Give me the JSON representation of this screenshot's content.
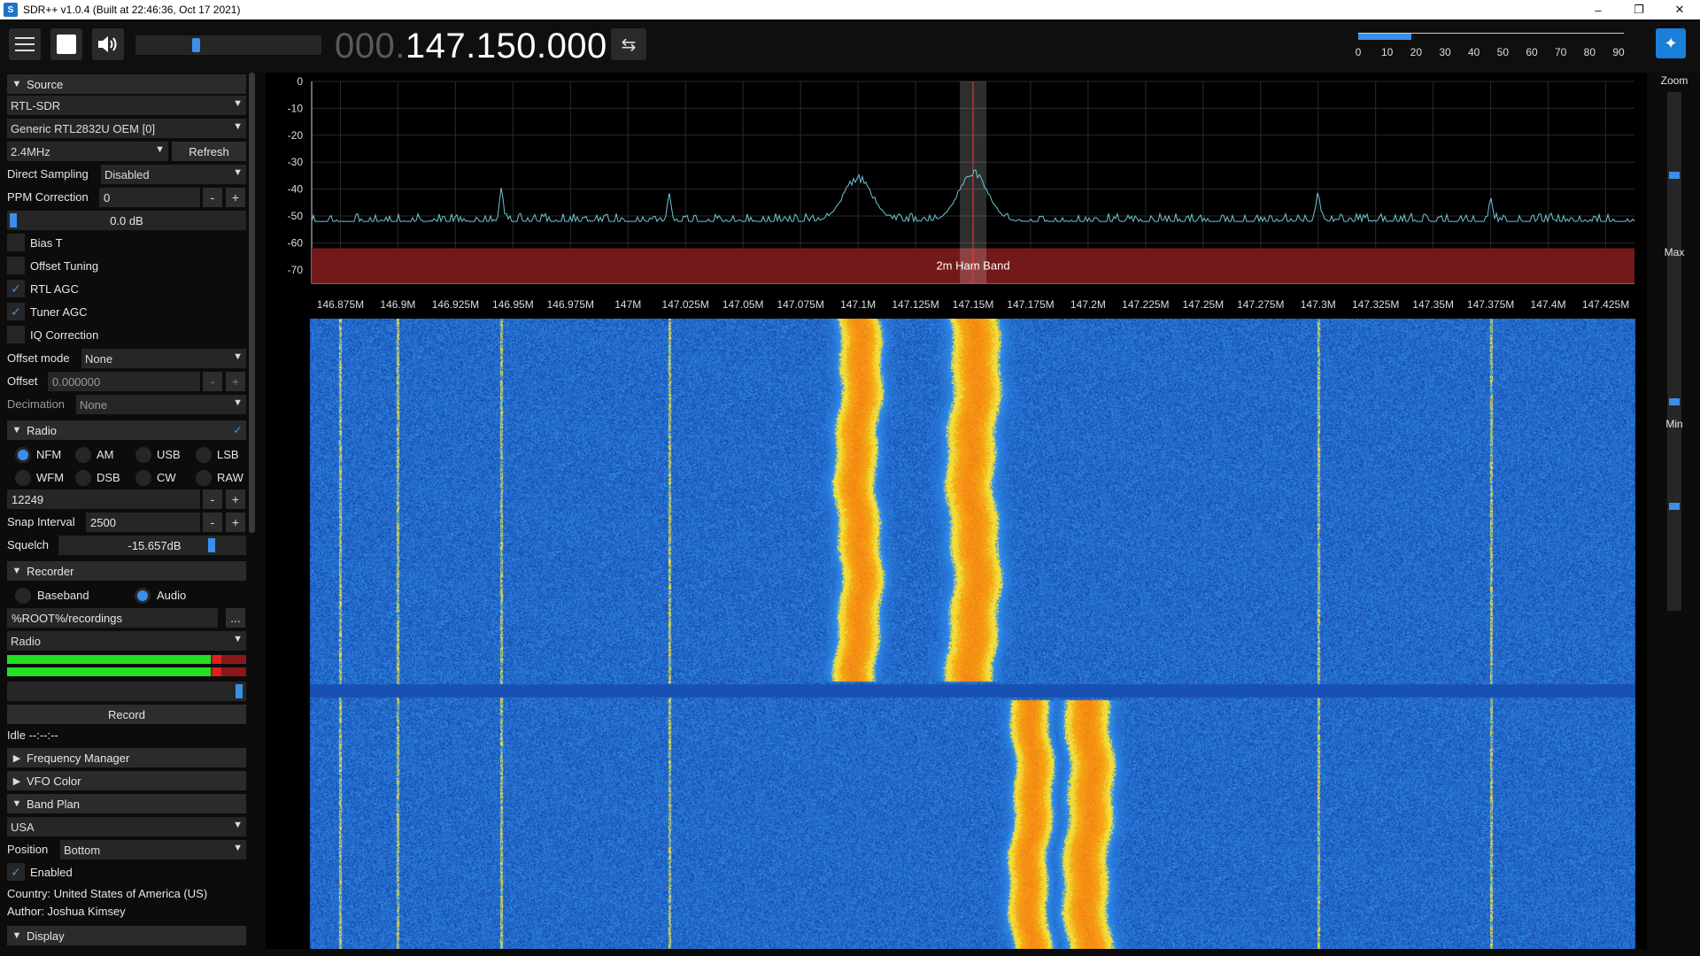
{
  "window": {
    "title": "SDR++ v1.0.4 (Built at 22:46:36, Oct 17 2021)",
    "minimize": "–",
    "maximize": "❐",
    "close": "✕"
  },
  "toolbar": {
    "frequency_dim": "000.",
    "frequency_lit": "147.150.000",
    "swap_icon": "⇆",
    "volume_level": 0.3,
    "snr_scale": [
      "0",
      "10",
      "20",
      "30",
      "40",
      "50",
      "60",
      "70",
      "80",
      "90"
    ],
    "snr_level": 20
  },
  "sidebar": {
    "source": {
      "header": "Source",
      "device_type": "RTL-SDR",
      "device": "Generic RTL2832U OEM [0]",
      "sample_rate": "2.4MHz",
      "refresh": "Refresh",
      "direct_sampling_label": "Direct Sampling",
      "direct_sampling_value": "Disabled",
      "ppm_label": "PPM Correction",
      "ppm_value": "0",
      "gain_value": "0.0 dB",
      "bias_t": "Bias T",
      "offset_tuning": "Offset Tuning",
      "rtl_agc": "RTL AGC",
      "tuner_agc": "Tuner AGC",
      "iq_correction": "IQ Correction",
      "offset_mode_label": "Offset mode",
      "offset_mode_value": "None",
      "offset_label": "Offset",
      "offset_value": "0.000000",
      "decimation_label": "Decimation",
      "decimation_value": "None"
    },
    "radio": {
      "header": "Radio",
      "modes": [
        "NFM",
        "AM",
        "USB",
        "LSB",
        "WFM",
        "DSB",
        "CW",
        "RAW"
      ],
      "selected_mode": "NFM",
      "bandwidth_value": "12249",
      "snap_label": "Snap Interval",
      "snap_value": "2500",
      "squelch_label": "Squelch",
      "squelch_value": "-15.657dB"
    },
    "recorder": {
      "header": "Recorder",
      "baseband": "Baseband",
      "audio": "Audio",
      "path": "%ROOT%/recordings",
      "browse": "...",
      "stream": "Radio",
      "record": "Record",
      "status": "Idle --:--:--"
    },
    "frequency_manager": {
      "header": "Frequency Manager"
    },
    "vfo_color": {
      "header": "VFO Color"
    },
    "band_plan": {
      "header": "Band Plan",
      "plan": "USA",
      "position_label": "Position",
      "position_value": "Bottom",
      "enabled": "Enabled",
      "country": "Country: United States of America (US)",
      "author": "Author: Joshua Kimsey"
    },
    "display": {
      "header": "Display"
    },
    "minus": "-",
    "plus": "+"
  },
  "chart_data": {
    "type": "line",
    "title": "",
    "xlabel": "",
    "ylabel": "",
    "ylim": [
      -75,
      0
    ],
    "y_ticks": [
      "0",
      "-10",
      "-20",
      "-30",
      "-40",
      "-50",
      "-60",
      "-70"
    ],
    "x_ticks": [
      "146.875M",
      "146.9M",
      "146.925M",
      "146.95M",
      "146.975M",
      "147M",
      "147.025M",
      "147.05M",
      "147.075M",
      "147.1M",
      "147.125M",
      "147.15M",
      "147.175M",
      "147.2M",
      "147.225M",
      "147.25M",
      "147.275M",
      "147.3M",
      "147.325M",
      "147.35M",
      "147.375M",
      "147.4M",
      "147.425M"
    ],
    "xlim_mhz": [
      146.8625,
      147.4375
    ],
    "band_label": "2m Ham Band",
    "vfo_center_mhz": 147.15,
    "noise_floor_db": -52,
    "signals": [
      {
        "freq_mhz": 147.1,
        "peak_db": -36
      },
      {
        "freq_mhz": 147.15,
        "peak_db": -34
      },
      {
        "freq_mhz": 146.945,
        "peak_db": -40
      },
      {
        "freq_mhz": 147.018,
        "peak_db": -42
      },
      {
        "freq_mhz": 147.3,
        "peak_db": -41
      },
      {
        "freq_mhz": 147.375,
        "peak_db": -44
      }
    ]
  },
  "right_panel": {
    "zoom": "Zoom",
    "max": "Max",
    "min": "Min"
  },
  "colors": {
    "accent": "#3b8fe8",
    "band": "#7a1a1a",
    "trace": "#6ec6d6",
    "waterfall_bg": "#1f52b0"
  }
}
